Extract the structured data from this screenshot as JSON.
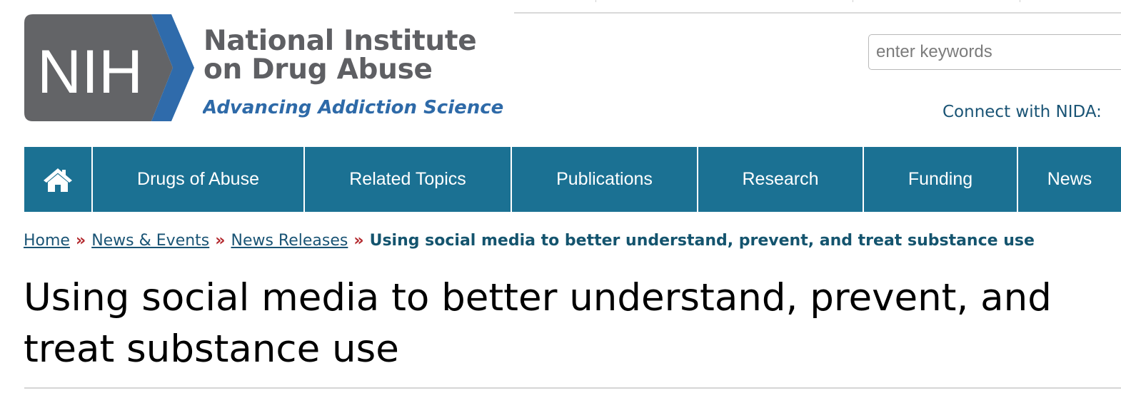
{
  "header": {
    "logo": {
      "badge_text": "NIH",
      "title_line1": "National Institute",
      "title_line2": "on Drug Abuse",
      "tagline": "Advancing Addiction Science"
    },
    "search": {
      "placeholder": "enter keywords",
      "value": ""
    },
    "connect_label": "Connect with NIDA:"
  },
  "nav": {
    "home_icon": "home-icon",
    "items": [
      {
        "label": "Drugs of Abuse"
      },
      {
        "label": "Related Topics"
      },
      {
        "label": "Publications"
      },
      {
        "label": "Research"
      },
      {
        "label": "Funding"
      },
      {
        "label": "News"
      }
    ]
  },
  "breadcrumb": {
    "separator": "»",
    "links": [
      {
        "label": "Home"
      },
      {
        "label": "News & Events"
      },
      {
        "label": "News Releases"
      }
    ],
    "current": "Using social media to better understand, prevent, and treat substance use"
  },
  "page": {
    "title": "Using social media to better understand, prevent, and treat substance use"
  },
  "colors": {
    "nav_background": "#1b7193",
    "logo_gray": "#5e5f63",
    "logo_blue": "#2e6aa8",
    "link": "#1a5475",
    "separator": "#b3282d"
  }
}
